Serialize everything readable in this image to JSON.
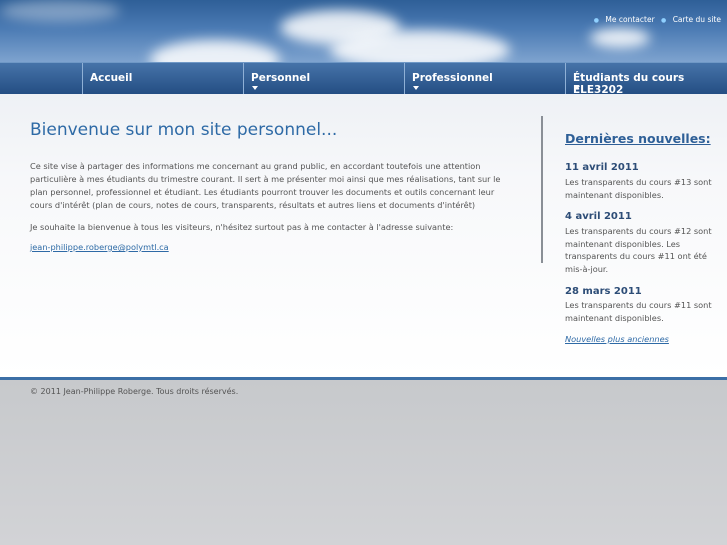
{
  "header": {
    "top_links": [
      "Me contacter",
      "Carte du site"
    ]
  },
  "nav": {
    "items": [
      {
        "label": "Accueil",
        "has_dropdown": false
      },
      {
        "label": "Personnel",
        "has_dropdown": true
      },
      {
        "label": "Professionnel",
        "has_dropdown": true
      },
      {
        "label": "Étudiants du cours ELE3202",
        "has_dropdown": true
      }
    ]
  },
  "main": {
    "title": "Bienvenue sur mon site personnel...",
    "paragraph1": "Ce site vise à partager des informations me concernant au grand public, en accordant toutefois une attention particulière à mes étudiants du trimestre courant. Il sert à me présenter moi ainsi que mes réalisations, tant sur le plan personnel, professionnel et étudiant. Les étudiants pourront trouver les documents et outils concernant leur cours d'intérêt (plan de cours, notes de cours, transparents, résultats et autres liens et documents d'intérêt)",
    "paragraph2": "Je souhaite la bienvenue à tous les visiteurs, n'hésitez surtout pas à me contacter à l'adresse suivante:",
    "email": "jean-philippe.roberge@polymtl.ca"
  },
  "sidebar": {
    "title": "Dernières nouvelles:",
    "news": [
      {
        "date": "11 avril 2011",
        "text": "Les transparents du cours #13 sont maintenant disponibles."
      },
      {
        "date": "4 avril 2011",
        "text": "Les transparents du cours #12 sont maintenant disponibles. Les transparents du cours #11 ont été mis-à-jour."
      },
      {
        "date": "28 mars 2011",
        "text": "Les transparents du cours #11 sont maintenant disponibles."
      }
    ],
    "older_link": "Nouvelles plus anciennes"
  },
  "footer": {
    "copyright": "© 2011 Jean-Philippe Roberge. Tous droits réservés."
  },
  "colors": {
    "accent": "#2e6aa6",
    "nav": "#2c5a91"
  }
}
